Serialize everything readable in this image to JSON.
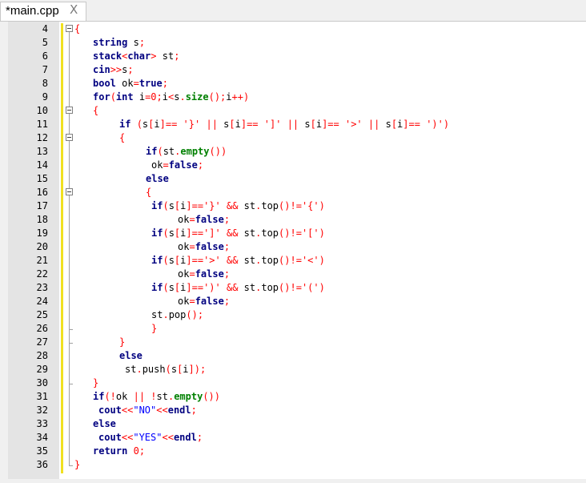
{
  "tab": {
    "title": "*main.cpp",
    "close_glyph": "X"
  },
  "lines": [
    {
      "n": "4",
      "indent": 0,
      "tokens": [
        [
          "op",
          "{"
        ]
      ]
    },
    {
      "n": "5",
      "indent": 1,
      "tokens": [
        [
          "kw",
          "string"
        ],
        [
          "txt",
          " s"
        ],
        [
          "op",
          ";"
        ]
      ]
    },
    {
      "n": "6",
      "indent": 1,
      "tokens": [
        [
          "kw",
          "stack"
        ],
        [
          "op",
          "<"
        ],
        [
          "kw",
          "char"
        ],
        [
          "op",
          ">"
        ],
        [
          "txt",
          " st"
        ],
        [
          "op",
          ";"
        ]
      ]
    },
    {
      "n": "7",
      "indent": 1,
      "tokens": [
        [
          "kw",
          "cin"
        ],
        [
          "op",
          ">>"
        ],
        [
          "txt",
          "s"
        ],
        [
          "op",
          ";"
        ]
      ]
    },
    {
      "n": "8",
      "indent": 1,
      "tokens": [
        [
          "kw",
          "bool"
        ],
        [
          "txt",
          " ok"
        ],
        [
          "op",
          "="
        ],
        [
          "kw",
          "true"
        ],
        [
          "op",
          ";"
        ]
      ]
    },
    {
      "n": "9",
      "indent": 1,
      "tokens": [
        [
          "kw",
          "for"
        ],
        [
          "op",
          "("
        ],
        [
          "kw",
          "int"
        ],
        [
          "txt",
          " i"
        ],
        [
          "op",
          "="
        ],
        [
          "num",
          "0"
        ],
        [
          "op",
          ";"
        ],
        [
          "txt",
          "i"
        ],
        [
          "op",
          "<"
        ],
        [
          "txt",
          "s"
        ],
        [
          "op",
          "."
        ],
        [
          "gr",
          "size"
        ],
        [
          "op",
          "();"
        ],
        [
          "txt",
          "i"
        ],
        [
          "op",
          "++)"
        ]
      ]
    },
    {
      "n": "10",
      "indent": 1,
      "tokens": [
        [
          "op",
          "{"
        ]
      ]
    },
    {
      "n": "11",
      "indent": 2,
      "tokens": [
        [
          "kw",
          "if"
        ],
        [
          "txt",
          " "
        ],
        [
          "op",
          "("
        ],
        [
          "txt",
          "s"
        ],
        [
          "op",
          "["
        ],
        [
          "txt",
          "i"
        ],
        [
          "op",
          "]=="
        ],
        [
          "txt",
          " "
        ],
        [
          "op",
          "'}'"
        ],
        [
          "txt",
          " "
        ],
        [
          "op",
          "||"
        ],
        [
          "txt",
          " s"
        ],
        [
          "op",
          "["
        ],
        [
          "txt",
          "i"
        ],
        [
          "op",
          "]=="
        ],
        [
          "txt",
          " "
        ],
        [
          "op",
          "']'"
        ],
        [
          "txt",
          " "
        ],
        [
          "op",
          "||"
        ],
        [
          "txt",
          " s"
        ],
        [
          "op",
          "["
        ],
        [
          "txt",
          "i"
        ],
        [
          "op",
          "]=="
        ],
        [
          "txt",
          " "
        ],
        [
          "op",
          "'>'"
        ],
        [
          "txt",
          " "
        ],
        [
          "op",
          "||"
        ],
        [
          "txt",
          " s"
        ],
        [
          "op",
          "["
        ],
        [
          "txt",
          "i"
        ],
        [
          "op",
          "]=="
        ],
        [
          "txt",
          " "
        ],
        [
          "op",
          "')')"
        ]
      ]
    },
    {
      "n": "12",
      "indent": 2,
      "tokens": [
        [
          "op",
          "{"
        ]
      ]
    },
    {
      "n": "13",
      "indent": 3,
      "tokens": [
        [
          "kw",
          "if"
        ],
        [
          "op",
          "("
        ],
        [
          "txt",
          "st"
        ],
        [
          "op",
          "."
        ],
        [
          "gr",
          "empty"
        ],
        [
          "op",
          "())"
        ]
      ]
    },
    {
      "n": "14",
      "indent": 3,
      "pad": 1,
      "tokens": [
        [
          "txt",
          "ok"
        ],
        [
          "op",
          "="
        ],
        [
          "kw",
          "false"
        ],
        [
          "op",
          ";"
        ]
      ]
    },
    {
      "n": "15",
      "indent": 3,
      "tokens": [
        [
          "kw",
          "else"
        ]
      ]
    },
    {
      "n": "16",
      "indent": 3,
      "tokens": [
        [
          "op",
          "{"
        ]
      ]
    },
    {
      "n": "17",
      "indent": 3,
      "pad": 1,
      "tokens": [
        [
          "kw",
          "if"
        ],
        [
          "op",
          "("
        ],
        [
          "txt",
          "s"
        ],
        [
          "op",
          "["
        ],
        [
          "txt",
          "i"
        ],
        [
          "op",
          "]=='}'"
        ],
        [
          "txt",
          " "
        ],
        [
          "op",
          "&&"
        ],
        [
          "txt",
          " st"
        ],
        [
          "op",
          "."
        ],
        [
          "txt",
          "top"
        ],
        [
          "op",
          "()!='{')"
        ]
      ]
    },
    {
      "n": "18",
      "indent": 4,
      "pad": 1,
      "tokens": [
        [
          "txt",
          "ok"
        ],
        [
          "op",
          "="
        ],
        [
          "kw",
          "false"
        ],
        [
          "op",
          ";"
        ]
      ]
    },
    {
      "n": "19",
      "indent": 3,
      "pad": 1,
      "tokens": [
        [
          "kw",
          "if"
        ],
        [
          "op",
          "("
        ],
        [
          "txt",
          "s"
        ],
        [
          "op",
          "["
        ],
        [
          "txt",
          "i"
        ],
        [
          "op",
          "]==']'"
        ],
        [
          "txt",
          " "
        ],
        [
          "op",
          "&&"
        ],
        [
          "txt",
          " st"
        ],
        [
          "op",
          "."
        ],
        [
          "txt",
          "top"
        ],
        [
          "op",
          "()!='[')"
        ]
      ]
    },
    {
      "n": "20",
      "indent": 4,
      "pad": 1,
      "tokens": [
        [
          "txt",
          "ok"
        ],
        [
          "op",
          "="
        ],
        [
          "kw",
          "false"
        ],
        [
          "op",
          ";"
        ]
      ]
    },
    {
      "n": "21",
      "indent": 3,
      "pad": 1,
      "tokens": [
        [
          "kw",
          "if"
        ],
        [
          "op",
          "("
        ],
        [
          "txt",
          "s"
        ],
        [
          "op",
          "["
        ],
        [
          "txt",
          "i"
        ],
        [
          "op",
          "]=='>'"
        ],
        [
          "txt",
          " "
        ],
        [
          "op",
          "&&"
        ],
        [
          "txt",
          " st"
        ],
        [
          "op",
          "."
        ],
        [
          "txt",
          "top"
        ],
        [
          "op",
          "()!='<')"
        ]
      ]
    },
    {
      "n": "22",
      "indent": 4,
      "pad": 1,
      "tokens": [
        [
          "txt",
          "ok"
        ],
        [
          "op",
          "="
        ],
        [
          "kw",
          "false"
        ],
        [
          "op",
          ";"
        ]
      ]
    },
    {
      "n": "23",
      "indent": 3,
      "pad": 1,
      "tokens": [
        [
          "kw",
          "if"
        ],
        [
          "op",
          "("
        ],
        [
          "txt",
          "s"
        ],
        [
          "op",
          "["
        ],
        [
          "txt",
          "i"
        ],
        [
          "op",
          "]==')'"
        ],
        [
          "txt",
          " "
        ],
        [
          "op",
          "&&"
        ],
        [
          "txt",
          " st"
        ],
        [
          "op",
          "."
        ],
        [
          "txt",
          "top"
        ],
        [
          "op",
          "()!='(')"
        ]
      ]
    },
    {
      "n": "24",
      "indent": 4,
      "pad": 1,
      "tokens": [
        [
          "txt",
          "ok"
        ],
        [
          "op",
          "="
        ],
        [
          "kw",
          "false"
        ],
        [
          "op",
          ";"
        ]
      ]
    },
    {
      "n": "25",
      "indent": 3,
      "pad": 1,
      "tokens": [
        [
          "txt",
          "st"
        ],
        [
          "op",
          "."
        ],
        [
          "txt",
          "pop"
        ],
        [
          "op",
          "();"
        ]
      ]
    },
    {
      "n": "26",
      "indent": 3,
      "pad": 1,
      "tokens": [
        [
          "op",
          "}"
        ]
      ]
    },
    {
      "n": "27",
      "indent": 2,
      "tokens": [
        [
          "op",
          "}"
        ]
      ]
    },
    {
      "n": "28",
      "indent": 2,
      "tokens": [
        [
          "kw",
          "else"
        ]
      ]
    },
    {
      "n": "29",
      "indent": 2,
      "pad": 1,
      "tokens": [
        [
          "txt",
          "st"
        ],
        [
          "op",
          "."
        ],
        [
          "txt",
          "push"
        ],
        [
          "op",
          "("
        ],
        [
          "txt",
          "s"
        ],
        [
          "op",
          "["
        ],
        [
          "txt",
          "i"
        ],
        [
          "op",
          "]);"
        ]
      ]
    },
    {
      "n": "30",
      "indent": 1,
      "tokens": [
        [
          "op",
          "}"
        ]
      ]
    },
    {
      "n": "31",
      "indent": 1,
      "tokens": [
        [
          "kw",
          "if"
        ],
        [
          "op",
          "(!"
        ],
        [
          "txt",
          "ok"
        ],
        [
          "txt",
          " "
        ],
        [
          "op",
          "||"
        ],
        [
          "txt",
          " "
        ],
        [
          "op",
          "!"
        ],
        [
          "txt",
          "st"
        ],
        [
          "op",
          "."
        ],
        [
          "gr",
          "empty"
        ],
        [
          "op",
          "())"
        ]
      ]
    },
    {
      "n": "32",
      "indent": 1,
      "pad": 1,
      "tokens": [
        [
          "kw",
          "cout"
        ],
        [
          "op",
          "<<"
        ],
        [
          "str",
          "\"NO\""
        ],
        [
          "op",
          "<<"
        ],
        [
          "kw",
          "endl"
        ],
        [
          "op",
          ";"
        ]
      ]
    },
    {
      "n": "33",
      "indent": 1,
      "tokens": [
        [
          "kw",
          "else"
        ]
      ]
    },
    {
      "n": "34",
      "indent": 1,
      "pad": 1,
      "tokens": [
        [
          "kw",
          "cout"
        ],
        [
          "op",
          "<<"
        ],
        [
          "str",
          "\"YES\""
        ],
        [
          "op",
          "<<"
        ],
        [
          "kw",
          "endl"
        ],
        [
          "op",
          ";"
        ]
      ]
    },
    {
      "n": "35",
      "indent": 1,
      "tokens": [
        [
          "kw",
          "return"
        ],
        [
          "txt",
          " "
        ],
        [
          "num",
          "0"
        ],
        [
          "op",
          ";"
        ]
      ]
    },
    {
      "n": "36",
      "indent": 0,
      "tokens": [
        [
          "op",
          "}"
        ]
      ]
    }
  ],
  "colors": {
    "keyword": "#000080",
    "operator": "#ff0000",
    "string": "#0000ff",
    "method": "#008000",
    "change_bar": "#f0e020"
  }
}
